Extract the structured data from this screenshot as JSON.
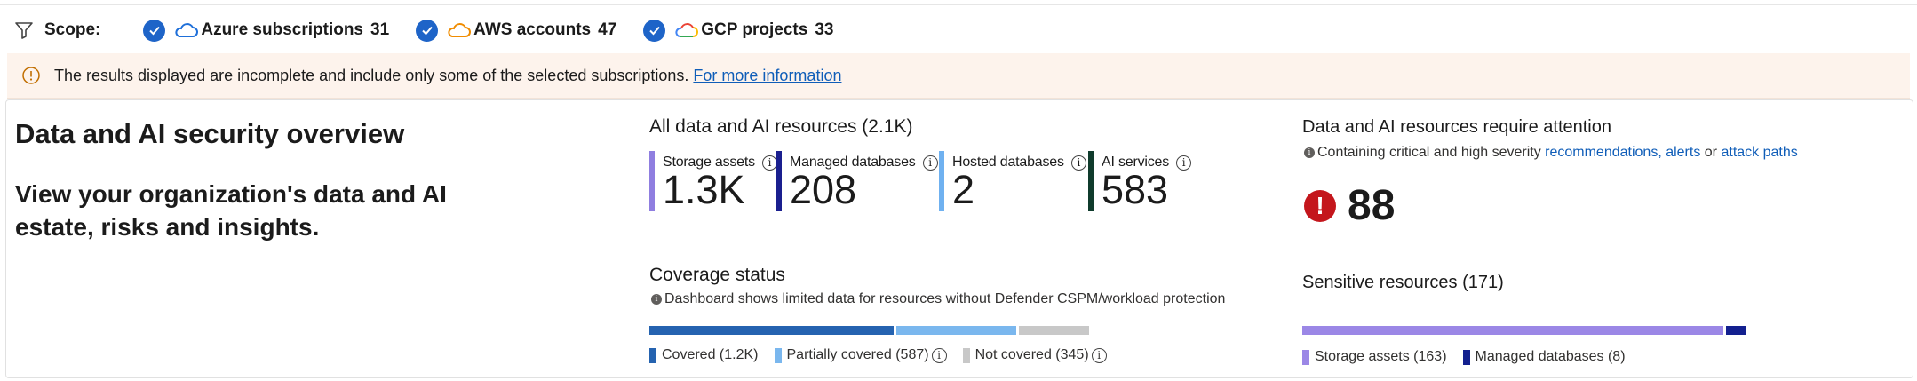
{
  "scope": {
    "label": "Scope:",
    "filter_icon": "filter-icon",
    "items": [
      {
        "name": "Azure subscriptions",
        "count": "31",
        "cloud_color": "#1e6fd9"
      },
      {
        "name": "AWS accounts",
        "count": "47",
        "cloud_color": "#f08c00"
      },
      {
        "name": "GCP projects",
        "count": "33",
        "cloud_color": "multicolor"
      }
    ]
  },
  "banner": {
    "text": "The results displayed are incomplete and include only some of the selected subscriptions.",
    "link": "For more information"
  },
  "overview": {
    "title": "Data and AI security overview",
    "subtitle": "View your organization's data and AI estate, risks and insights."
  },
  "resources": {
    "title": "All data and AI resources (2.1K)",
    "metrics": [
      {
        "label": "Storage assets",
        "value": "1.3K",
        "color": "#8f7ee0"
      },
      {
        "label": "Managed databases",
        "value": "208",
        "color": "#1a1f8f"
      },
      {
        "label": "Hosted databases",
        "value": "2",
        "color": "#6fb1f0"
      },
      {
        "label": "AI services",
        "value": "583",
        "color": "#0f3b2c"
      }
    ]
  },
  "coverage": {
    "title": "Coverage status",
    "note": "Dashboard shows limited data for resources without Defender CSPM/workload protection",
    "segments": [
      {
        "label": "Covered (1.2K)",
        "value": 1200,
        "color": "#2563b0"
      },
      {
        "label": "Partially covered (587)",
        "value": 587,
        "color": "#7ab7ee"
      },
      {
        "label": "Not covered (345)",
        "value": 345,
        "color": "#c8c8c8"
      }
    ]
  },
  "attention": {
    "title": "Data and AI resources require attention",
    "note_prefix": "Containing critical and high severity",
    "link1": "recommendations, alerts",
    "or": "or",
    "link2": "attack paths",
    "count": "88"
  },
  "sensitive": {
    "title": "Sensitive resources (171)",
    "segments": [
      {
        "label": "Storage assets (163)",
        "value": 163,
        "color": "#9b87e6"
      },
      {
        "label": "Managed databases (8)",
        "value": 8,
        "color": "#13208f"
      }
    ]
  }
}
